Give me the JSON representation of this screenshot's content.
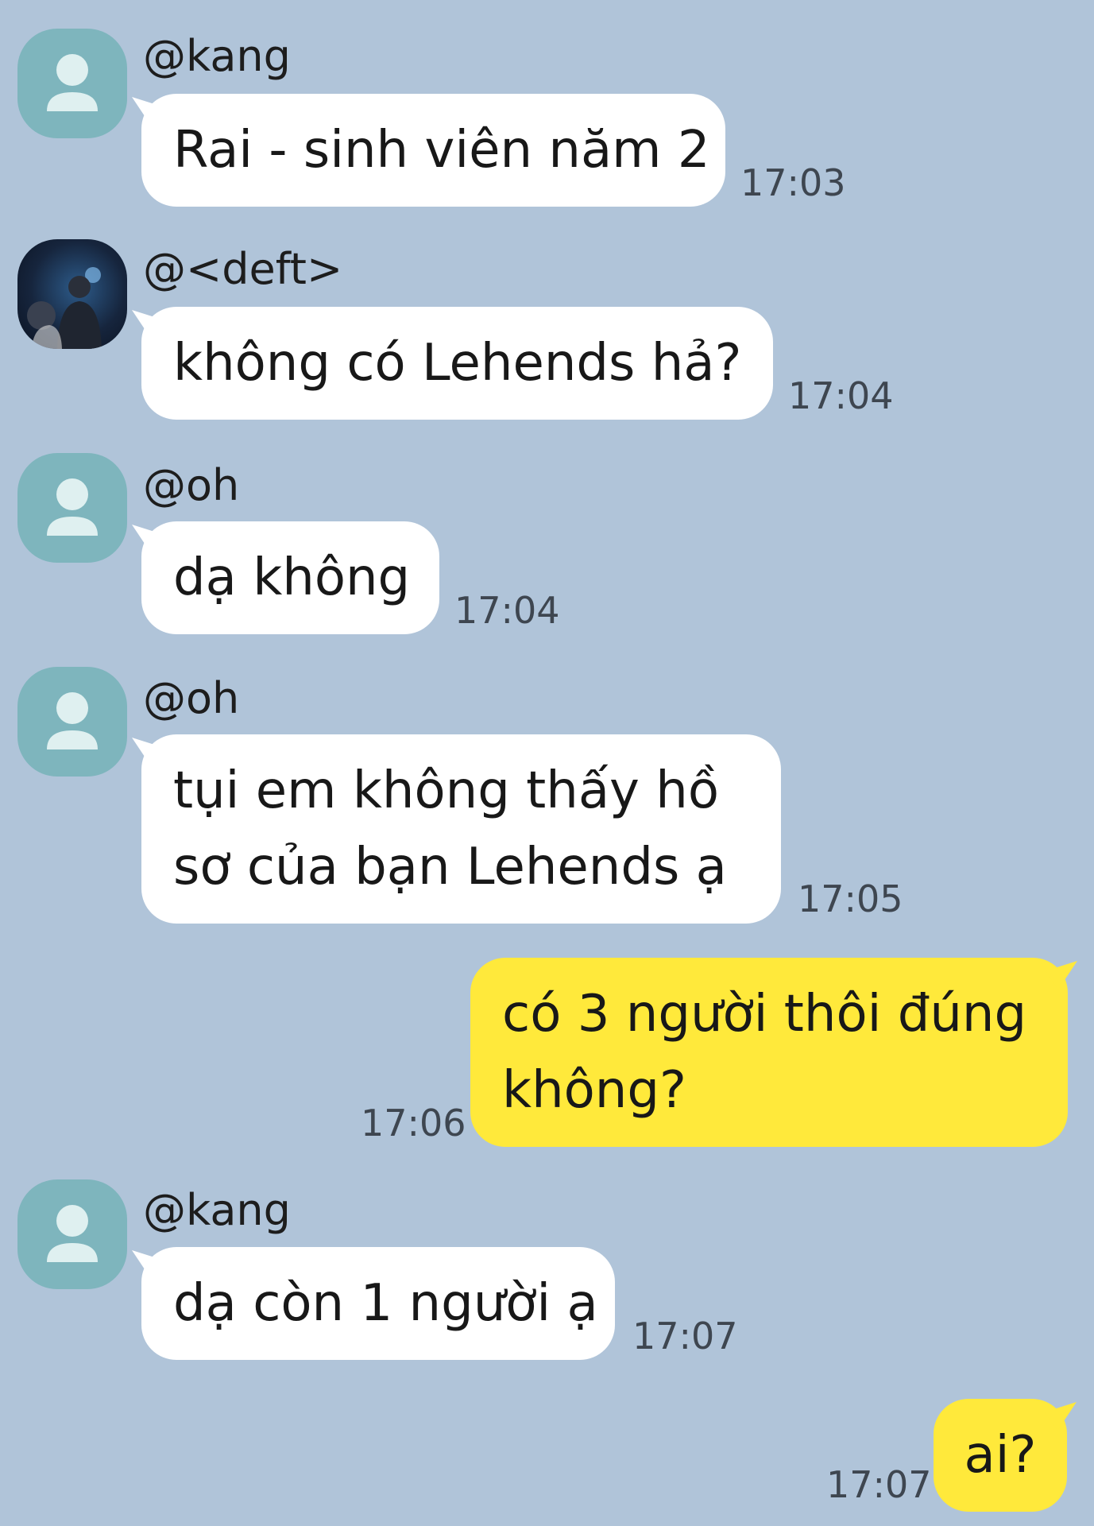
{
  "colors": {
    "chat_background": "#b0c4d9",
    "incoming_bubble": "#ffffff",
    "outgoing_bubble": "#ffe93b",
    "default_avatar": "#7eb5bd"
  },
  "messages": [
    {
      "sender": "@kang",
      "avatar": "default-profile-icon",
      "lines": [
        "Rai - sinh viên năm 2"
      ],
      "time": "17:03",
      "direction": "incoming"
    },
    {
      "sender": "@<deft>",
      "avatar": "profile-photo",
      "lines": [
        "không có Lehends hả?"
      ],
      "time": "17:04",
      "direction": "incoming"
    },
    {
      "sender": "@oh",
      "avatar": "default-profile-icon",
      "lines": [
        "dạ không"
      ],
      "time": "17:04",
      "direction": "incoming"
    },
    {
      "sender": "@oh",
      "avatar": "default-profile-icon",
      "lines": [
        "tụi em không thấy hồ",
        "sơ của bạn Lehends ạ"
      ],
      "time": "17:05",
      "direction": "incoming"
    },
    {
      "lines": [
        "có 3 người thôi đúng",
        "không?"
      ],
      "time": "17:06",
      "direction": "outgoing"
    },
    {
      "sender": "@kang",
      "avatar": "default-profile-icon",
      "lines": [
        "dạ còn 1 người ạ"
      ],
      "time": "17:07",
      "direction": "incoming"
    },
    {
      "lines": [
        "ai?"
      ],
      "time": "17:07",
      "direction": "outgoing"
    }
  ]
}
